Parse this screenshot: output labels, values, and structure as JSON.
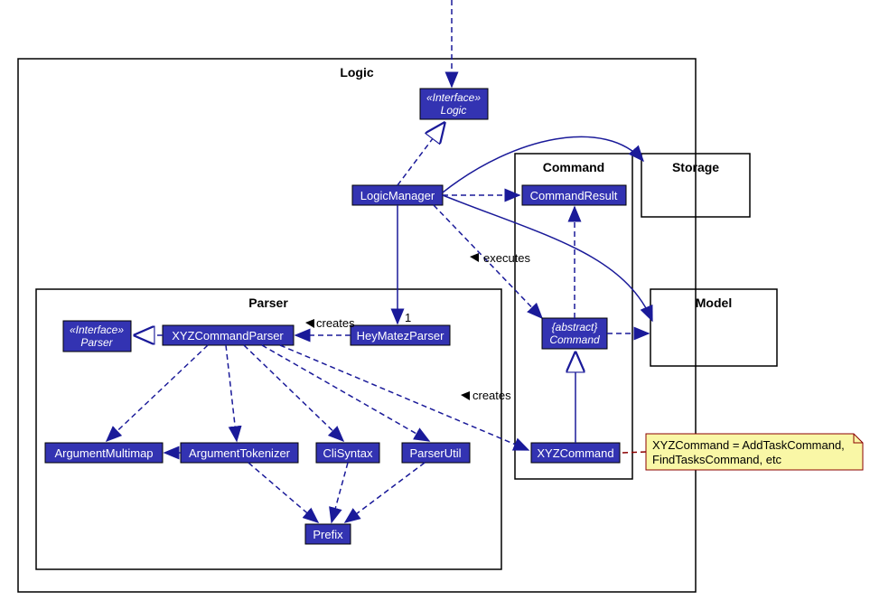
{
  "packages": {
    "logic": "Logic",
    "parser": "Parser",
    "command": "Command",
    "storage": "Storage",
    "model": "Model"
  },
  "classes": {
    "iLogic": {
      "stereo": "«Interface»",
      "name": "Logic"
    },
    "iParser": {
      "stereo": "«Interface»",
      "name": "Parser"
    },
    "logicManager": "LogicManager",
    "xyzCmdParser": "XYZCommandParser",
    "heyMatez": "HeyMatezParser",
    "argMulti": "ArgumentMultimap",
    "argTok": "ArgumentTokenizer",
    "cliSyntax": "CliSyntax",
    "parserUtil": "ParserUtil",
    "prefix": "Prefix",
    "cmdResult": "CommandResult",
    "absCmd": {
      "stereo": "{abstract}",
      "name": "Command"
    },
    "xyzCmd": "XYZCommand"
  },
  "labels": {
    "creates1": "creates",
    "creates2": "creates",
    "executes": "executes",
    "one": "1"
  },
  "note": {
    "l1": "XYZCommand = AddTaskCommand,",
    "l2": "FindTasksCommand, etc"
  },
  "chart_data": {
    "type": "uml-class-diagram",
    "packages": [
      {
        "name": "Logic",
        "contains": [
          "Logic(interface)",
          "LogicManager",
          "Parser(pkg)",
          "Command(pkg)"
        ]
      },
      {
        "name": "Parser",
        "contains": [
          "Parser(interface)",
          "XYZCommandParser",
          "HeyMatezParser",
          "ArgumentMultimap",
          "ArgumentTokenizer",
          "CliSyntax",
          "ParserUtil",
          "Prefix"
        ]
      },
      {
        "name": "Command",
        "contains": [
          "CommandResult",
          "Command(abstract)",
          "XYZCommand"
        ]
      },
      {
        "name": "Storage",
        "contains": []
      },
      {
        "name": "Model",
        "contains": []
      }
    ],
    "relationships": [
      {
        "from": "external",
        "to": "Logic(interface)",
        "type": "dependency"
      },
      {
        "from": "LogicManager",
        "to": "Logic(interface)",
        "type": "realization"
      },
      {
        "from": "LogicManager",
        "to": "HeyMatezParser",
        "type": "association",
        "mult": "1"
      },
      {
        "from": "LogicManager",
        "to": "CommandResult",
        "type": "dependency"
      },
      {
        "from": "LogicManager",
        "to": "Command(abstract)",
        "type": "dependency",
        "label": "executes"
      },
      {
        "from": "LogicManager",
        "to": "Storage",
        "type": "association"
      },
      {
        "from": "LogicManager",
        "to": "Model",
        "type": "association"
      },
      {
        "from": "HeyMatezParser",
        "to": "XYZCommandParser",
        "type": "dependency",
        "label": "creates"
      },
      {
        "from": "XYZCommandParser",
        "to": "Parser(interface)",
        "type": "realization"
      },
      {
        "from": "XYZCommandParser",
        "to": "ArgumentMultimap",
        "type": "dependency"
      },
      {
        "from": "XYZCommandParser",
        "to": "ArgumentTokenizer",
        "type": "dependency"
      },
      {
        "from": "XYZCommandParser",
        "to": "CliSyntax",
        "type": "dependency"
      },
      {
        "from": "XYZCommandParser",
        "to": "ParserUtil",
        "type": "dependency"
      },
      {
        "from": "XYZCommandParser",
        "to": "XYZCommand",
        "type": "dependency",
        "label": "creates"
      },
      {
        "from": "ArgumentTokenizer",
        "to": "ArgumentMultimap",
        "type": "dependency"
      },
      {
        "from": "ArgumentTokenizer",
        "to": "Prefix",
        "type": "dependency"
      },
      {
        "from": "CliSyntax",
        "to": "Prefix",
        "type": "dependency"
      },
      {
        "from": "ParserUtil",
        "to": "Prefix",
        "type": "dependency"
      },
      {
        "from": "XYZCommand",
        "to": "Command(abstract)",
        "type": "generalization"
      },
      {
        "from": "Command(abstract)",
        "to": "CommandResult",
        "type": "dependency"
      },
      {
        "from": "Command(abstract)",
        "to": "Model",
        "type": "dependency"
      },
      {
        "from": "Note",
        "to": "XYZCommand",
        "type": "note-link"
      }
    ]
  }
}
